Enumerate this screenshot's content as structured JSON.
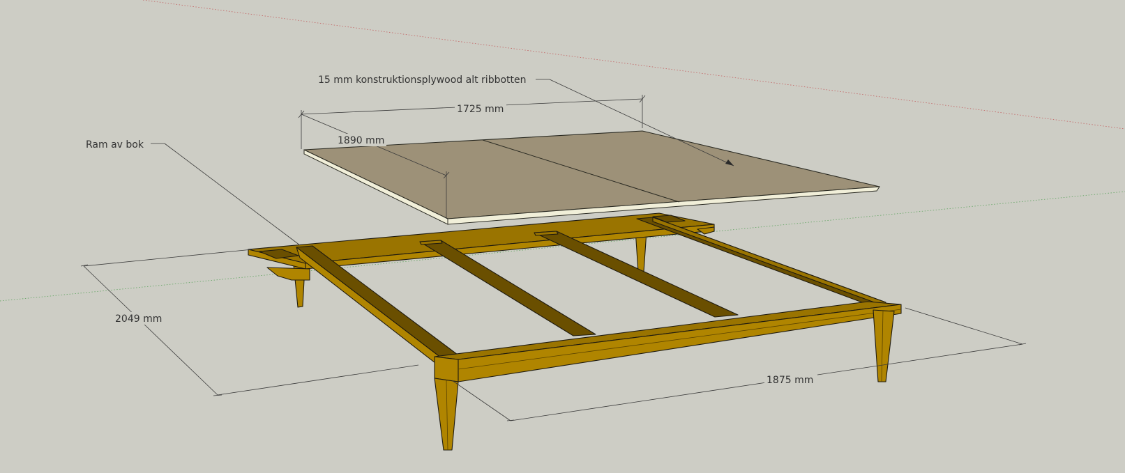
{
  "labels": {
    "plywood_note": "15 mm konstruktionsplywood alt ribbotten",
    "frame_note": "Ram av bok",
    "dim_sheet_width": "1725 mm",
    "dim_sheet_depth": "1890 mm",
    "dim_frame_depth": "2049 mm",
    "dim_frame_width": "1875 mm"
  },
  "colors": {
    "background": "#cdcdc5",
    "plywood_top": "#9d9178",
    "plywood_edge": "#f1efd9",
    "wood_light": "#b08500",
    "wood_top": "#9a7400",
    "wood_dark": "#6a4f00",
    "axis_red": "#c46a6a",
    "axis_green": "#6aa86a"
  }
}
